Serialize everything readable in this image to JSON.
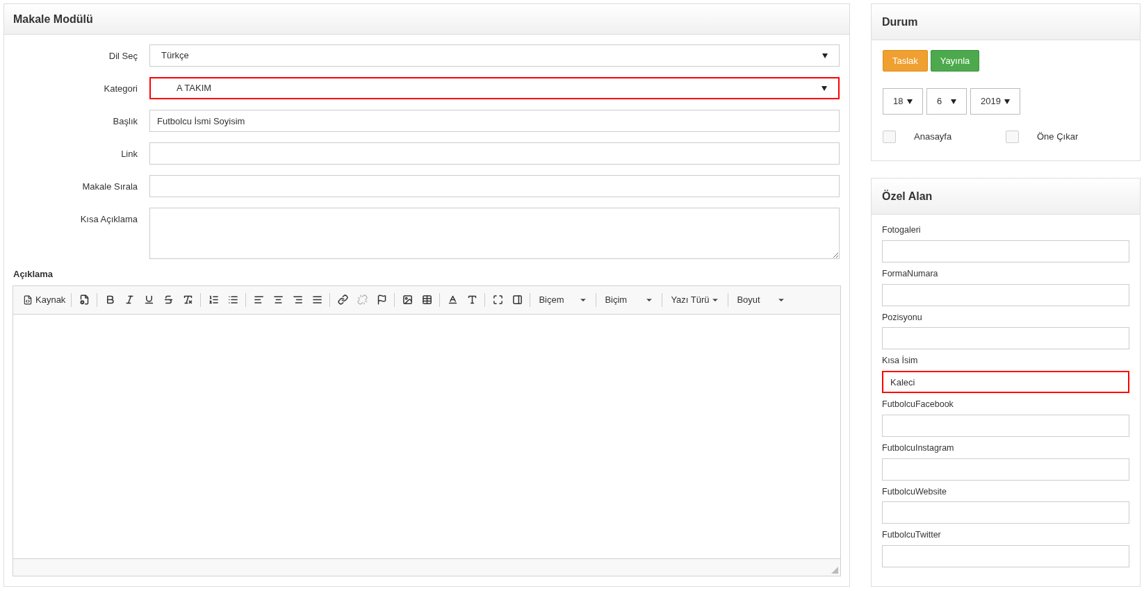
{
  "main_panel": {
    "title": "Makale Modülü",
    "fields": [
      {
        "label": "Dil Seç",
        "kind": "select",
        "value": "Türkçe",
        "highlighted": false
      },
      {
        "label": "Kategori",
        "kind": "select",
        "value": "A TAKIM",
        "highlighted": true
      },
      {
        "label": "Başlık",
        "kind": "input",
        "value": "Futbolcu İsmi Soyisim",
        "highlighted": false
      },
      {
        "label": "Link",
        "kind": "input",
        "highlighted": false
      },
      {
        "label": "Makale Sırala",
        "kind": "input",
        "highlighted": false
      },
      {
        "label": "Kısa Açıklama",
        "kind": "textarea",
        "highlighted": false
      }
    ],
    "editor": {
      "label": "Açıklama",
      "source_label": "Kaynak",
      "unlink_disabled": true,
      "dropdowns": [
        "Biçem",
        "Biçim",
        "Yazı Türü",
        "Boyut"
      ]
    }
  },
  "status_panel": {
    "title": "Durum",
    "buttons": [
      {
        "label": "Taslak",
        "kind": "warning"
      },
      {
        "label": "Yayınla",
        "kind": "success"
      }
    ],
    "date": [
      "18",
      "6",
      "2019"
    ],
    "checkboxes": [
      {
        "label": "Anasayfa",
        "checked": false
      },
      {
        "label": "Öne Çıkar",
        "checked": false
      }
    ]
  },
  "custom_panel": {
    "title": "Özel Alan",
    "fields": [
      {
        "label": "Fotogaleri",
        "highlighted": false
      },
      {
        "label": "FormaNumara",
        "highlighted": false
      },
      {
        "label": "Pozisyonu",
        "highlighted": false
      },
      {
        "label": "Kısa İsim",
        "value": "Kaleci",
        "highlighted": true
      },
      {
        "label": "FutbolcuFacebook",
        "highlighted": false
      },
      {
        "label": "FutbolcuInstagram",
        "highlighted": false
      },
      {
        "label": "FutbolcuWebsite",
        "highlighted": false
      },
      {
        "label": "FutbolcuTwitter",
        "highlighted": false
      }
    ]
  }
}
